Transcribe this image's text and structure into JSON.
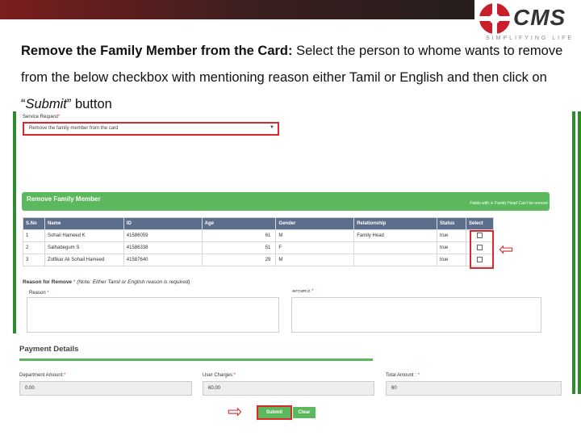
{
  "brand": {
    "logo_text": "CMS",
    "tagline": "SIMPLIFYING LIFE"
  },
  "instruction": {
    "heading": "Remove the Family Member from the Card:",
    "text_1": " Select the person to whome wants to remove from the below checkbox with mentioning reason either Tamil or English and then click on “",
    "submit_word": "Submit",
    "text_2": "” button"
  },
  "form": {
    "service_label": "Service Request",
    "service_value": "Remove the family member from the card",
    "panel_title": "Remove Family Member",
    "panel_note": "Fields with ∗ Family Head Can't be remove",
    "columns": [
      "S.No",
      "Name",
      "ID",
      "Age",
      "Gender",
      "Relationship",
      "Status",
      "Select"
    ],
    "rows": [
      [
        "1",
        "Sohail Hameed K",
        "41586059",
        "61",
        "M",
        "Family Head",
        "true"
      ],
      [
        "2",
        "Salhabegum S",
        "41586338",
        "51",
        "F",
        "",
        "true"
      ],
      [
        "3",
        "Zolfikar Ali Sohail Hameed",
        "41587640",
        "29",
        "M",
        "",
        "true"
      ]
    ],
    "reason_title": "Reason for Remove",
    "reason_note": "(Note: Either Tamil or English reason is required)",
    "reason_en_label": "Reason",
    "reason_ta_label": "காரணம்"
  },
  "payment": {
    "title": "Payment Details",
    "department_label": "Department Amount:",
    "department_value": "0.00",
    "user_label": "User Charges:",
    "user_value": "60.00",
    "total_label": "Total Amount :",
    "total_value": "60"
  },
  "buttons": {
    "submit": "Submit",
    "clear": "Clear"
  },
  "colors": {
    "accent_red": "#d9292b",
    "panel_green": "#5cb85c",
    "header_blue": "#5b6e8c"
  }
}
